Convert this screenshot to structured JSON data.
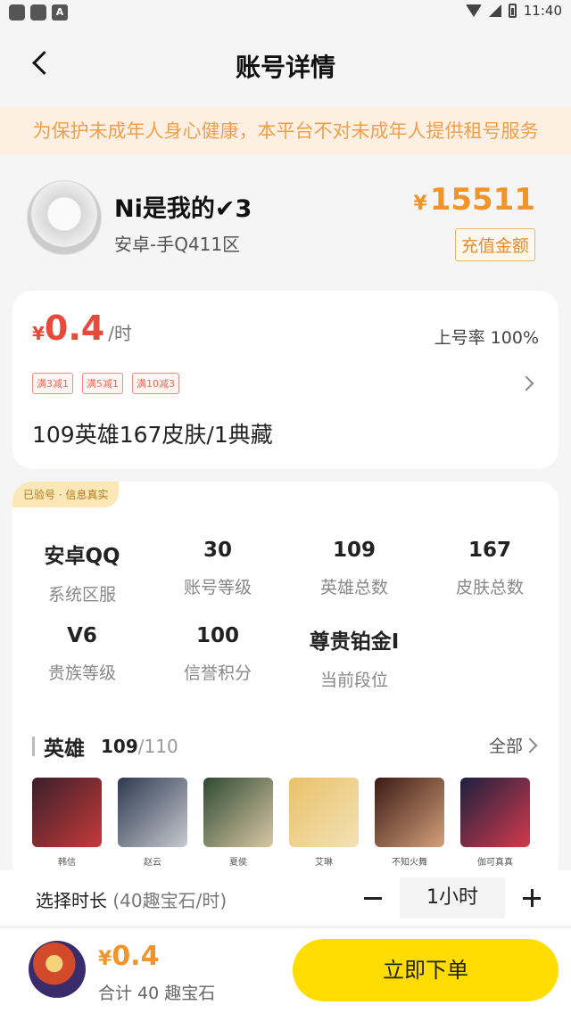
{
  "status_bar": {
    "time": "11:40",
    "notif_letter": "A"
  },
  "nav": {
    "title": "账号详情"
  },
  "notice": "为保护未成年人身心健康，本平台不对未成年人提供租号服务",
  "account": {
    "name": "Ni是我的✔3",
    "region": "安卓-手Q411区",
    "price_symbol": "¥",
    "price": "15511",
    "badge": "充值金额"
  },
  "rental": {
    "symbol": "¥",
    "price": "0.4",
    "unit": "/时",
    "rate": "上号率 100%",
    "coupons": [
      "满3减1",
      "满5减1",
      "满10减3"
    ],
    "summary": "109英雄167皮肤/1典藏"
  },
  "info": {
    "verified": "已验号 · 信息真实",
    "stats": [
      {
        "value": "安卓QQ",
        "label": "系统区服"
      },
      {
        "value": "30",
        "label": "账号等级"
      },
      {
        "value": "109",
        "label": "英雄总数"
      },
      {
        "value": "167",
        "label": "皮肤总数"
      },
      {
        "value": "V6",
        "label": "贵族等级"
      },
      {
        "value": "100",
        "label": "信誉积分"
      },
      {
        "value": "尊贵铂金I",
        "label": "当前段位"
      }
    ]
  },
  "heroes": {
    "title": "英雄",
    "count": "109",
    "total": "/110",
    "all_label": "全部",
    "list": [
      {
        "name": "韩信",
        "colors": [
          "#3a1f2a",
          "#c63a3a"
        ]
      },
      {
        "name": "赵云",
        "colors": [
          "#2d3a4f",
          "#c7c9cf"
        ]
      },
      {
        "name": "夏侯",
        "colors": [
          "#2f4a33",
          "#d9c7a3"
        ]
      },
      {
        "name": "艾琳",
        "colors": [
          "#e9c16a",
          "#f2e2b5"
        ]
      },
      {
        "name": "不知火舞",
        "colors": [
          "#3a1a14",
          "#d4a07a"
        ]
      },
      {
        "name": "伽可真真",
        "colors": [
          "#1c2040",
          "#d43a4a"
        ]
      }
    ]
  },
  "duration": {
    "label": "选择时长",
    "sub": " (40趣宝石/时)",
    "value": "1小时"
  },
  "bottom": {
    "symbol": "¥",
    "price": "0.4",
    "total": "合计 40 趣宝石",
    "order": "立即下单"
  }
}
